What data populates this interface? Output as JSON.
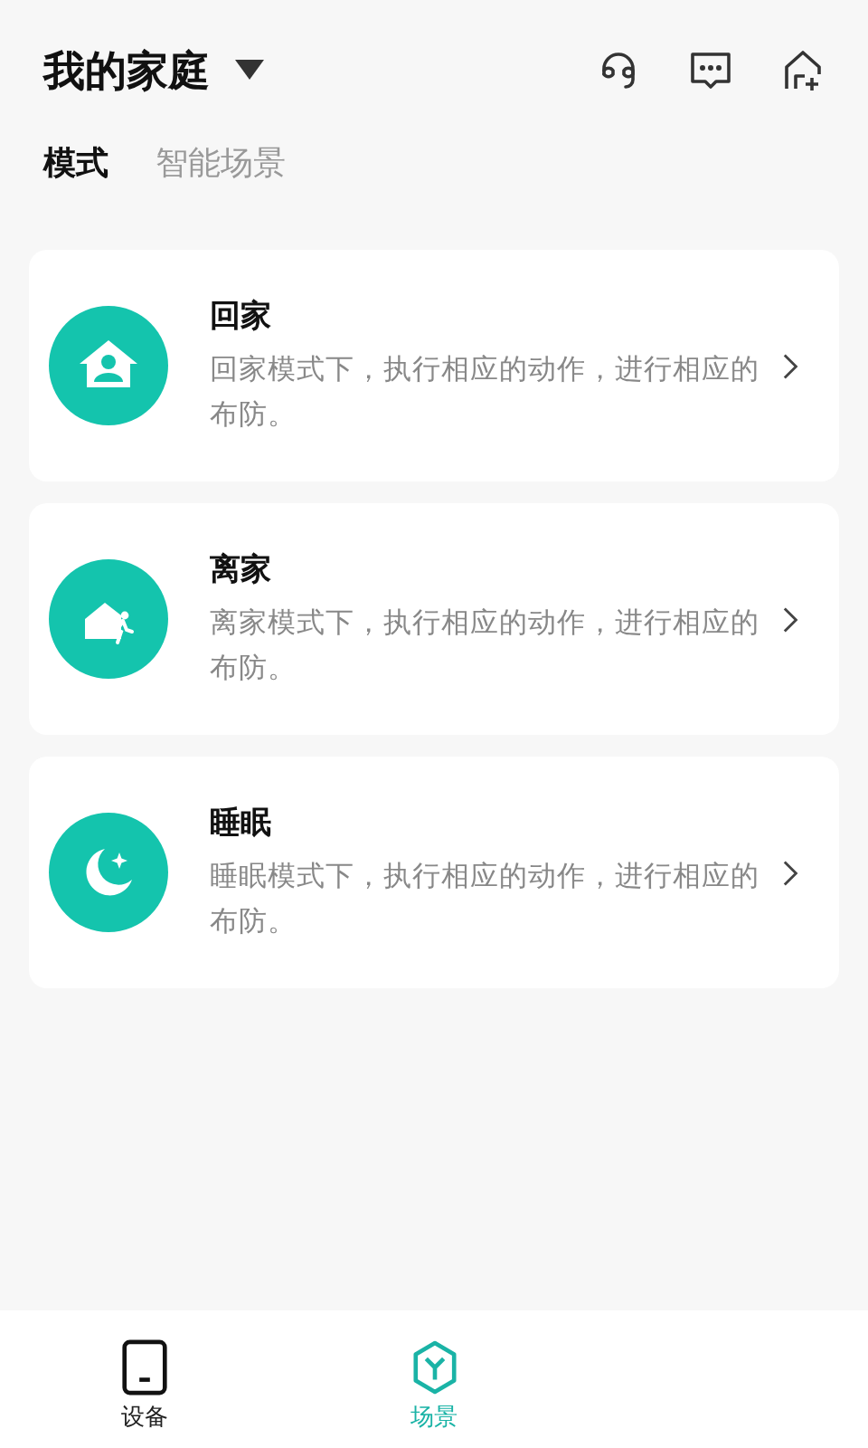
{
  "header": {
    "title": "我的家庭"
  },
  "tabs": [
    {
      "label": "模式",
      "selected": true
    },
    {
      "label": "智能场景",
      "selected": false
    }
  ],
  "modes": [
    {
      "kind": "home",
      "title": "回家",
      "description": "回家模式下，执行相应的动作，进行相应的布防。"
    },
    {
      "kind": "away",
      "title": "离家",
      "description": "离家模式下，执行相应的动作，进行相应的布防。"
    },
    {
      "kind": "sleep",
      "title": "睡眠",
      "description": "睡眠模式下，执行相应的动作，进行相应的布防。"
    }
  ],
  "bottom_nav": [
    {
      "kind": "device",
      "label": "设备",
      "selected": false
    },
    {
      "kind": "scene",
      "label": "场景",
      "selected": true
    }
  ]
}
